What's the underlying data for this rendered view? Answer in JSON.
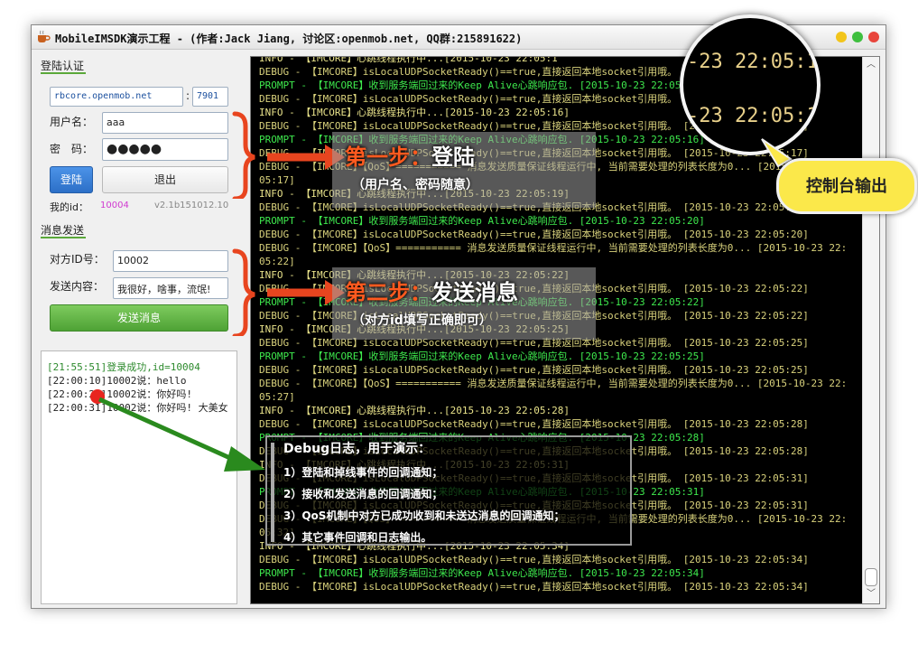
{
  "window": {
    "title": "MobileIMSDK演示工程 - (作者:Jack Jiang, 讨论区:openmob.net, QQ群:215891622)"
  },
  "login": {
    "section_title": "登陆认证",
    "server_value": "rbcore.openmob.net",
    "port_value": "7901",
    "username_label": "用户名：",
    "username_value": "aaa",
    "password_label": "密　码：",
    "password_value": "●●●●●",
    "login_button": "登陆",
    "logout_button": "退出",
    "myid_label": "我的id：",
    "myid_value": "10004",
    "version": "v2.1b151012.10"
  },
  "send": {
    "section_title": "消息发送",
    "target_label": "对方ID号：",
    "target_value": "10002",
    "content_label": "发送内容：",
    "content_value": "我很好，啥事，流氓!",
    "send_button": "发送消息"
  },
  "chatlog": [
    {
      "kind": "ok",
      "text": "[21:55:51]登录成功,id=10004"
    },
    {
      "kind": "msg",
      "text": "[22:00:10]10002说：hello"
    },
    {
      "kind": "msg",
      "text": "[22:00:20]10002说：你好吗!"
    },
    {
      "kind": "msg",
      "text": "[22:00:31]10002说：你好吗! 大美女"
    }
  ],
  "console": [
    {
      "lv": "info",
      "text": "INFO - 【IMCORE】心跳线程执行中...[2015-10-23 22:05:1"
    },
    {
      "lv": "debug",
      "text": "DEBUG - 【IMCORE】isLocalUDPSocketReady()==true,直接返回本地socket引用哦。 [2015-10-23 22:05:16]"
    },
    {
      "lv": "prompt",
      "text": "PROMPT - 【IMCORE】收到服务端回过来的Keep Alive心跳响应包. [2015-10-23 22:05:16]"
    },
    {
      "lv": "debug",
      "text": "DEBUG - 【IMCORE】isLocalUDPSocketReady()==true,直接返回本地socket引用哦。 [2015-10-23 22:05:16]"
    },
    {
      "lv": "info",
      "text": "INFO - 【IMCORE】心跳线程执行中...[2015-10-23 22:05:16]"
    },
    {
      "lv": "debug",
      "text": "DEBUG - 【IMCORE】isLocalUDPSocketReady()==true,直接返回本地socket引用哦。 [2015-10-23 22:05:16]"
    },
    {
      "lv": "prompt",
      "text": "PROMPT - 【IMCORE】收到服务端回过来的Keep Alive心跳响应包. [2015-10-23 22:05:16]"
    },
    {
      "lv": "debug",
      "text": "DEBUG - 【IMCORE】isLocalUDPSocketReady()==true,直接返回本地socket引用哦。 [2015-10-23 22:05:17]"
    },
    {
      "lv": "debug",
      "text": "DEBUG - 【IMCORE】【QoS】=========== 消息发送质量保证线程运行中, 当前需要处理的列表长度为0... [2015-10-23 22:"
    },
    {
      "lv": "debug",
      "text": "05:17]"
    },
    {
      "lv": "info",
      "text": "INFO - 【IMCORE】心跳线程执行中...[2015-10-23 22:05:19]"
    },
    {
      "lv": "debug",
      "text": "DEBUG - 【IMCORE】isLocalUDPSocketReady()==true,直接返回本地socket引用哦。 [2015-10-23 22:05:19]"
    },
    {
      "lv": "prompt",
      "text": "PROMPT - 【IMCORE】收到服务端回过来的Keep Alive心跳响应包. [2015-10-23 22:05:20]"
    },
    {
      "lv": "debug",
      "text": "DEBUG - 【IMCORE】isLocalUDPSocketReady()==true,直接返回本地socket引用哦。 [2015-10-23 22:05:20]"
    },
    {
      "lv": "debug",
      "text": "DEBUG - 【IMCORE】【QoS】=========== 消息发送质量保证线程运行中, 当前需要处理的列表长度为0... [2015-10-23 22:"
    },
    {
      "lv": "debug",
      "text": "05:22]"
    },
    {
      "lv": "info",
      "text": "INFO - 【IMCORE】心跳线程执行中...[2015-10-23 22:05:22]"
    },
    {
      "lv": "debug",
      "text": "DEBUG - 【IMCORE】isLocalUDPSocketReady()==true,直接返回本地socket引用哦。 [2015-10-23 22:05:22]"
    },
    {
      "lv": "prompt",
      "text": "PROMPT - 【IMCORE】收到服务端回过来的Keep Alive心跳响应包. [2015-10-23 22:05:22]"
    },
    {
      "lv": "debug",
      "text": "DEBUG - 【IMCORE】isLocalUDPSocketReady()==true,直接返回本地socket引用哦。 [2015-10-23 22:05:22]"
    },
    {
      "lv": "info",
      "text": "INFO - 【IMCORE】心跳线程执行中...[2015-10-23 22:05:25]"
    },
    {
      "lv": "debug",
      "text": "DEBUG - 【IMCORE】isLocalUDPSocketReady()==true,直接返回本地socket引用哦。 [2015-10-23 22:05:25]"
    },
    {
      "lv": "prompt",
      "text": "PROMPT - 【IMCORE】收到服务端回过来的Keep Alive心跳响应包. [2015-10-23 22:05:25]"
    },
    {
      "lv": "debug",
      "text": "DEBUG - 【IMCORE】isLocalUDPSocketReady()==true,直接返回本地socket引用哦。 [2015-10-23 22:05:25]"
    },
    {
      "lv": "debug",
      "text": "DEBUG - 【IMCORE】【QoS】=========== 消息发送质量保证线程运行中, 当前需要处理的列表长度为0... [2015-10-23 22:"
    },
    {
      "lv": "debug",
      "text": "05:27]"
    },
    {
      "lv": "info",
      "text": "INFO - 【IMCORE】心跳线程执行中...[2015-10-23 22:05:28]"
    },
    {
      "lv": "debug",
      "text": "DEBUG - 【IMCORE】isLocalUDPSocketReady()==true,直接返回本地socket引用哦。 [2015-10-23 22:05:28]"
    },
    {
      "lv": "prompt",
      "text": "PROMPT - 【IMCORE】收到服务端回过来的Keep Alive心跳响应包. [2015-10-23 22:05:28]"
    },
    {
      "lv": "debug",
      "text": "DEBUG - 【IMCORE】isLocalUDPSocketReady()==true,直接返回本地socket引用哦。 [2015-10-23 22:05:28]"
    },
    {
      "lv": "info",
      "text": "INFO - 【IMCORE】心跳线程执行中...[2015-10-23 22:05:31]"
    },
    {
      "lv": "debug",
      "text": "DEBUG - 【IMCORE】isLocalUDPSocketReady()==true,直接返回本地socket引用哦。 [2015-10-23 22:05:31]"
    },
    {
      "lv": "prompt",
      "text": "PROMPT - 【IMCORE】收到服务端回过来的Keep Alive心跳响应包. [2015-10-23 22:05:31]"
    },
    {
      "lv": "debug",
      "text": "DEBUG - 【IMCORE】isLocalUDPSocketReady()==true,直接返回本地socket引用哦。 [2015-10-23 22:05:31]"
    },
    {
      "lv": "debug",
      "text": "DEBUG - 【IMCORE】【QoS】=========== 消息发送质量保证线程运行中, 当前需要处理的列表长度为0... [2015-10-23 22:"
    },
    {
      "lv": "debug",
      "text": "05:32]"
    },
    {
      "lv": "info",
      "text": "INFO - 【IMCORE】心跳线程执行中...[2015-10-23 22:05:34]"
    },
    {
      "lv": "debug",
      "text": "DEBUG - 【IMCORE】isLocalUDPSocketReady()==true,直接返回本地socket引用哦。 [2015-10-23 22:05:34]"
    },
    {
      "lv": "prompt",
      "text": "PROMPT - 【IMCORE】收到服务端回过来的Keep Alive心跳响应包. [2015-10-23 22:05:34]"
    },
    {
      "lv": "debug",
      "text": "DEBUG - 【IMCORE】isLocalUDPSocketReady()==true,直接返回本地socket引用哦。 [2015-10-23 22:05:34]"
    }
  ],
  "annotations": {
    "step1_title": "第一步：登陆",
    "step1_sub": "（用户名、密码随意）",
    "step2_title": "第二步：发送消息",
    "step2_sub": "（对方id填写正确即可）",
    "console_callout": "控制台输出",
    "magnifier_line1": "-23 22:05:1",
    "magnifier_line2": "-23 22:05:1",
    "note_title": "Debug日志，用于演示：",
    "note_items": [
      "1）登陆和掉线事件的回调通知；",
      "2）接收和发送消息的回调通知；",
      "3）QoS机制中对方已成功收到和未送达消息的回调通知；",
      "4）其它事件回调和日志输出。"
    ]
  },
  "colors": {
    "bracket_red": "#e8451f",
    "arrow_green": "#2a8a1e",
    "callout_yellow": "#fbe84a"
  }
}
